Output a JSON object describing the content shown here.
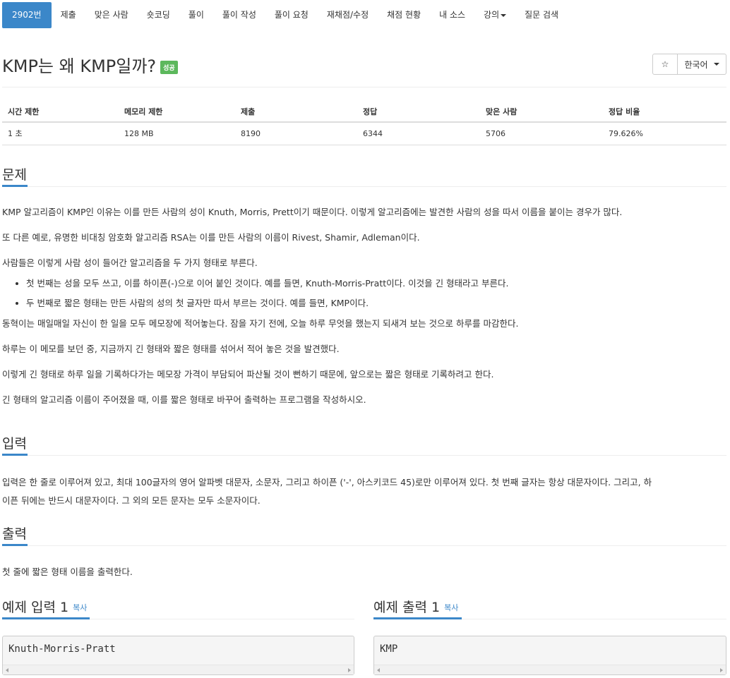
{
  "nav": {
    "items": [
      {
        "label": "2902번",
        "active": true
      },
      {
        "label": "제출"
      },
      {
        "label": "맞은 사람"
      },
      {
        "label": "숏코딩"
      },
      {
        "label": "풀이"
      },
      {
        "label": "풀이 작성"
      },
      {
        "label": "풀이 요청"
      },
      {
        "label": "재채점/수정"
      },
      {
        "label": "채점 현황"
      },
      {
        "label": "내 소스"
      },
      {
        "label": "강의"
      },
      {
        "label": "질문 검색"
      }
    ]
  },
  "title": {
    "text": "KMP는 왜 KMP일까?",
    "badge": "성공",
    "star_icon": "☆",
    "language": "한국어"
  },
  "info": {
    "headers": [
      "시간 제한",
      "메모리 제한",
      "제출",
      "정답",
      "맞은 사람",
      "정답 비율"
    ],
    "values": [
      "1 초",
      "128 MB",
      "8190",
      "6344",
      "5706",
      "79.626%"
    ]
  },
  "problem": {
    "heading": "문제",
    "p1": "KMP 알고리즘이 KMP인 이유는 이를 만든 사람의 성이 Knuth, Morris, Prett이기 때문이다. 이렇게 알고리즘에는 발견한 사람의 성을 따서 이름을 붙이는 경우가 많다.",
    "p2": "또 다른 예로, 유명한 비대칭 암호화 알고리즘 RSA는 이를 만든 사람의 이름이 Rivest, Shamir, Adleman이다.",
    "p3": "사람들은 이렇게 사람 성이 들어간 알고리즘을 두 가지 형태로 부른다.",
    "b1": "첫 번째는 성을 모두 쓰고, 이를 하이픈(-)으로 이어 붙인 것이다. 예를 들면, Knuth-Morris-Pratt이다. 이것을 긴 형태라고 부른다.",
    "b2": "두 번째로 짧은 형태는 만든 사람의 성의 첫 글자만 따서 부르는 것이다. 예를 들면, KMP이다.",
    "p4": "동혁이는 매일매일 자신이 한 일을 모두 메모장에 적어놓는다. 잠을 자기 전에, 오늘 하루 무엇을 했는지 되새겨 보는 것으로 하루를 마감한다.",
    "p5": "하루는 이 메모를 보던 중, 지금까지 긴 형태와 짧은 형태를 섞어서 적어 놓은 것을 발견했다.",
    "p6": "이렇게 긴 형태로 하루 일을 기록하다가는 메모장 가격이 부담되어 파산될 것이 뻔하기 때문에, 앞으로는 짧은 형태로 기록하려고 한다.",
    "p7": "긴 형태의 알고리즘 이름이 주어졌을 때, 이를 짧은 형태로 바꾸어 출력하는 프로그램을 작성하시오."
  },
  "input": {
    "heading": "입력",
    "line1": "입력은 한 줄로 이루어져 있고, 최대 100글자의 영어 알파벳 대문자, 소문자, 그리고 하이픈 ('-', 아스키코드 45)로만 이루어져 있다. 첫 번째 글자는 항상 대문자이다. 그리고, 하",
    "line2": "이픈 뒤에는 반드시 대문자이다. 그 외의 모든 문자는 모두 소문자이다."
  },
  "output": {
    "heading": "출력",
    "text": "첫 줄에 짧은 형태 이름을 출력한다."
  },
  "samples": {
    "input_heading": "예제 입력 1",
    "output_heading": "예제 출력 1",
    "copy_label": "복사",
    "input_value": "Knuth-Morris-Pratt",
    "output_value": "KMP"
  },
  "colors": {
    "accent": "#3b87c9",
    "success": "#5cb85c"
  }
}
